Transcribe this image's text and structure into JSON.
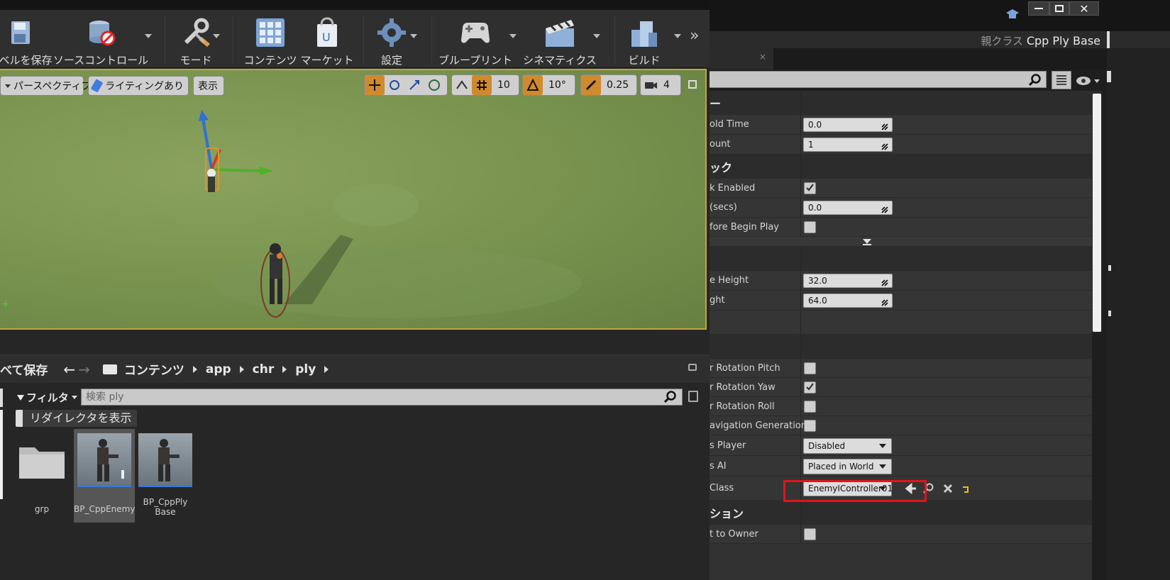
{
  "toolbar": {
    "items": [
      {
        "label": "ベルを保存",
        "icon": "save-icon"
      },
      {
        "label": "ソースコントロール",
        "icon": "source-control-icon"
      },
      {
        "label": "モード",
        "icon": "modes-icon"
      },
      {
        "label": "コンテンツ",
        "icon": "content-icon"
      },
      {
        "label": "マーケット",
        "icon": "marketplace-icon"
      },
      {
        "label": "設定",
        "icon": "settings-icon"
      },
      {
        "label": "ブループリント",
        "icon": "blueprint-icon"
      },
      {
        "label": "シネマティクス",
        "icon": "cinematics-icon"
      },
      {
        "label": "ビルド",
        "icon": "build-icon"
      }
    ],
    "overflow": "»"
  },
  "viewport": {
    "perspective_label": "パースペクティブ",
    "lighting_label": "ライティングあり",
    "show_label": "表示",
    "grid_snap": "10",
    "rotation_snap": "10°",
    "scale_snap": "0.25",
    "camera_speed": "4"
  },
  "content_browser": {
    "save_all": "べて保存",
    "breadcrumb": [
      "コンテンツ",
      "app",
      "chr",
      "ply"
    ],
    "filter_label": "フィルタ",
    "search_placeholder": "検索 ply",
    "redirector_label": "リダイレクタを表示",
    "assets": [
      {
        "name": "grp",
        "type": "folder"
      },
      {
        "name": "BP_CppEnemy",
        "type": "blueprint"
      },
      {
        "name": "BP_CppPly\nBase",
        "type": "blueprint"
      }
    ]
  },
  "details": {
    "parent_class_prefix": "親クラス",
    "parent_class": "Cpp Ply Base",
    "tab_close": "×",
    "rows": [
      {
        "type": "cat",
        "label": "ー"
      },
      {
        "type": "num",
        "label": "old Time",
        "value": "0.0"
      },
      {
        "type": "num",
        "label": "ount",
        "value": "1"
      },
      {
        "type": "cat",
        "label": "ック"
      },
      {
        "type": "chk",
        "label": "k Enabled",
        "checked": true
      },
      {
        "type": "num",
        "label": "(secs)",
        "value": "0.0"
      },
      {
        "type": "chk",
        "label": "fore Begin Play",
        "checked": false
      },
      {
        "type": "expander"
      },
      {
        "type": "cat",
        "label": ""
      },
      {
        "type": "num",
        "label": "e Height",
        "value": "32.0"
      },
      {
        "type": "num",
        "label": "ght",
        "value": "64.0"
      },
      {
        "type": "blank"
      },
      {
        "type": "cat",
        "label": ""
      },
      {
        "type": "chk",
        "label": "r Rotation Pitch",
        "checked": false
      },
      {
        "type": "chk",
        "label": "r Rotation Yaw",
        "checked": true
      },
      {
        "type": "chk",
        "label": "r Rotation Roll",
        "checked": false
      },
      {
        "type": "chk",
        "label": "avigation Generation",
        "checked": false
      },
      {
        "type": "combo",
        "label": "s Player",
        "value": "Disabled"
      },
      {
        "type": "combo",
        "label": "s AI",
        "value": "Placed in World"
      },
      {
        "type": "class",
        "label": "Class",
        "value": "EnemyIController01"
      },
      {
        "type": "cat",
        "label": "ション"
      },
      {
        "type": "chk",
        "label": "t to Owner",
        "checked": false
      }
    ]
  },
  "colors": {
    "accent": "#d08a2e",
    "highlight": "#e0141c",
    "viewport_border": "#c9a23a"
  }
}
